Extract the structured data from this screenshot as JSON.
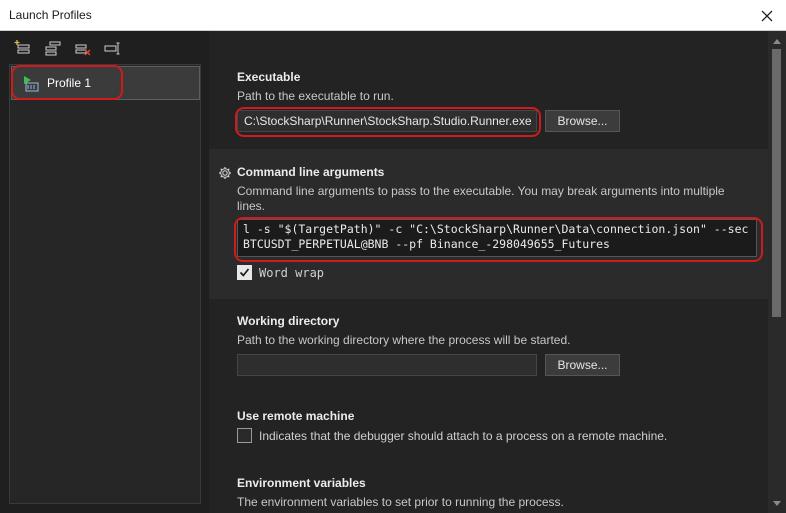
{
  "window": {
    "title": "Launch Profiles"
  },
  "toolbar": {
    "items": [
      {
        "icon": "new-profile-icon"
      },
      {
        "icon": "copy-profile-icon"
      },
      {
        "icon": "delete-profile-icon"
      },
      {
        "icon": "rename-profile-icon"
      }
    ]
  },
  "profiles": [
    {
      "label": "Profile 1",
      "selected": true
    }
  ],
  "executable": {
    "title": "Executable",
    "description": "Path to the executable to run.",
    "value": "C:\\StockSharp\\Runner\\StockSharp.Studio.Runner.exe",
    "browse_label": "Browse..."
  },
  "arguments": {
    "title": "Command line arguments",
    "description": "Command line arguments to pass to the executable. You may break arguments into multiple lines.",
    "line1": "l -s \"$(TargetPath)\" -c \"C:\\StockSharp\\Runner\\Data\\connection.json\" --sec",
    "line2": "BTCUSDT_PERPETUAL@BNB --pf Binance_-298049655_Futures",
    "word_wrap_label": "Word wrap",
    "word_wrap_checked": true,
    "icon": "gear-icon"
  },
  "working_directory": {
    "title": "Working directory",
    "description": "Path to the working directory where the process will be started.",
    "value": "",
    "browse_label": "Browse..."
  },
  "remote": {
    "title": "Use remote machine",
    "checkbox_label": "Indicates that the debugger should attach to a process on a remote machine.",
    "checked": false
  },
  "environment": {
    "title": "Environment variables",
    "description": "The environment variables to set prior to running the process."
  },
  "colors": {
    "highlight": "#d11a1a",
    "background": "#1f1f1f",
    "panel": "#232323"
  }
}
